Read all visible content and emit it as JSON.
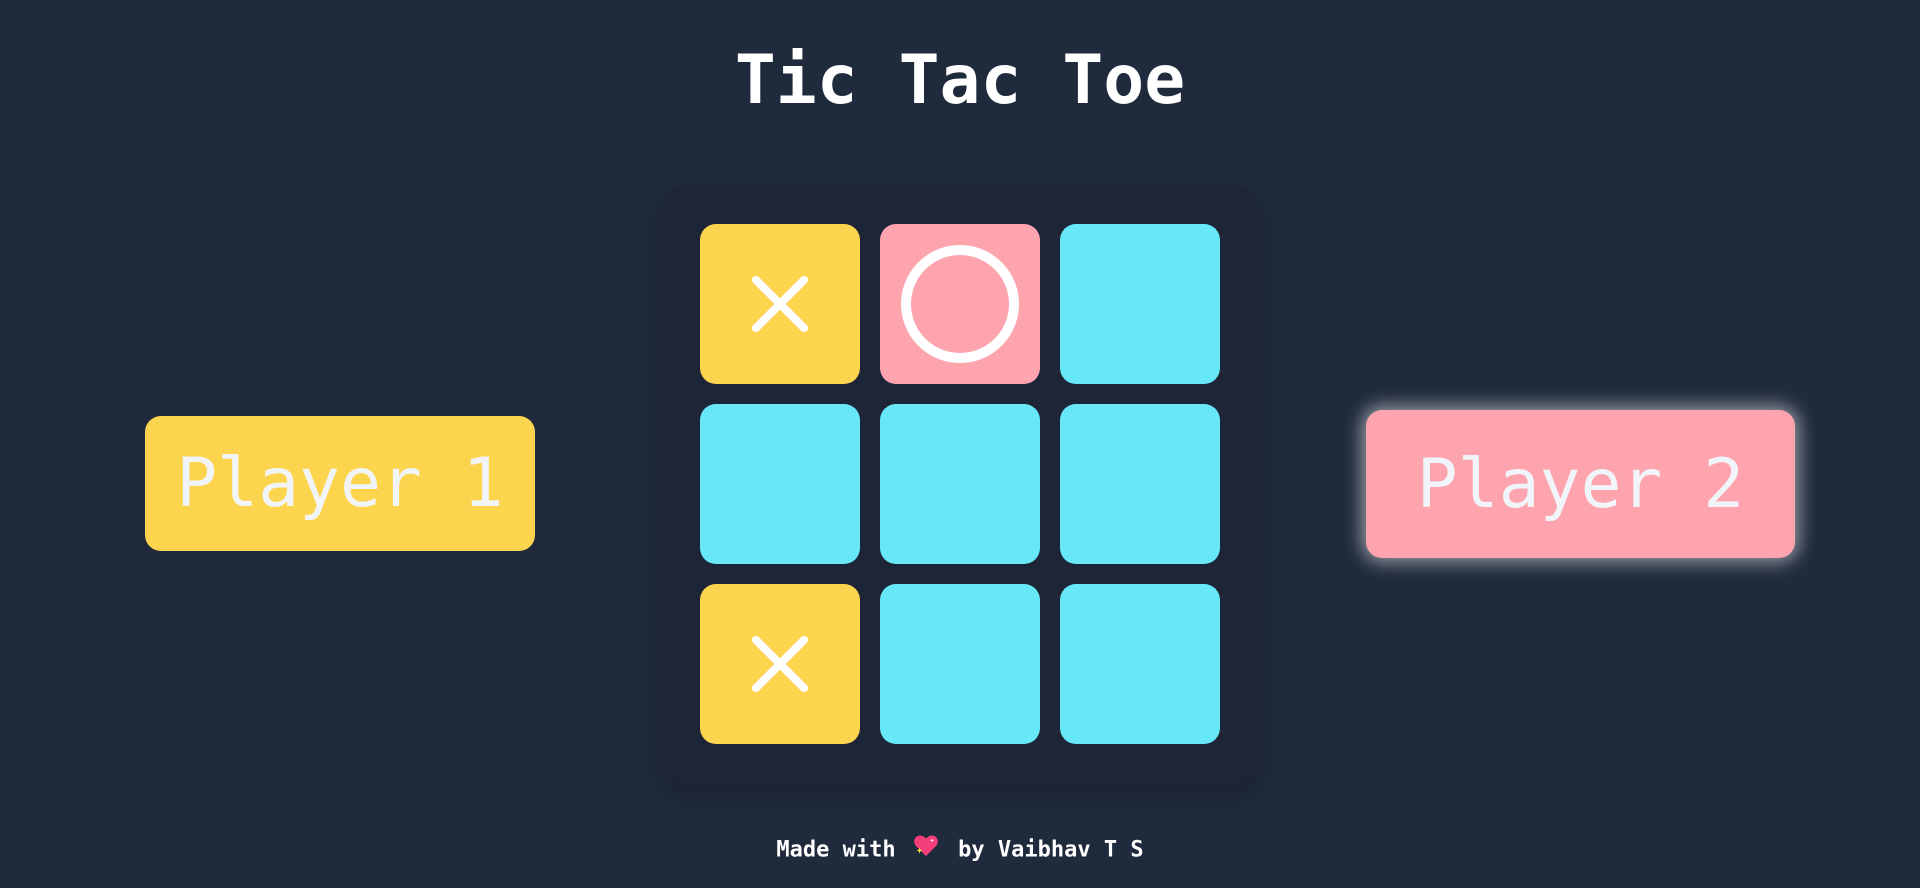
{
  "title": "Tic Tac Toe",
  "players": {
    "player1": {
      "label": "Player 1",
      "color": "#fdd44d"
    },
    "player2": {
      "label": "Player 2",
      "color": "#fda4ae",
      "active": true
    }
  },
  "board": {
    "cells": [
      "X",
      "O",
      "",
      "",
      "",
      "",
      "X",
      "",
      ""
    ]
  },
  "colors": {
    "background": "#1f2a3c",
    "board": "#1c2637",
    "empty_cell": "#67e8f9",
    "x_cell": "#fdd44d",
    "o_cell": "#fda4ae",
    "mark": "#ffffff"
  },
  "footer": {
    "prefix": "Made with",
    "icon": "sparkling-heart-icon",
    "suffix": "by Vaibhav T S"
  }
}
